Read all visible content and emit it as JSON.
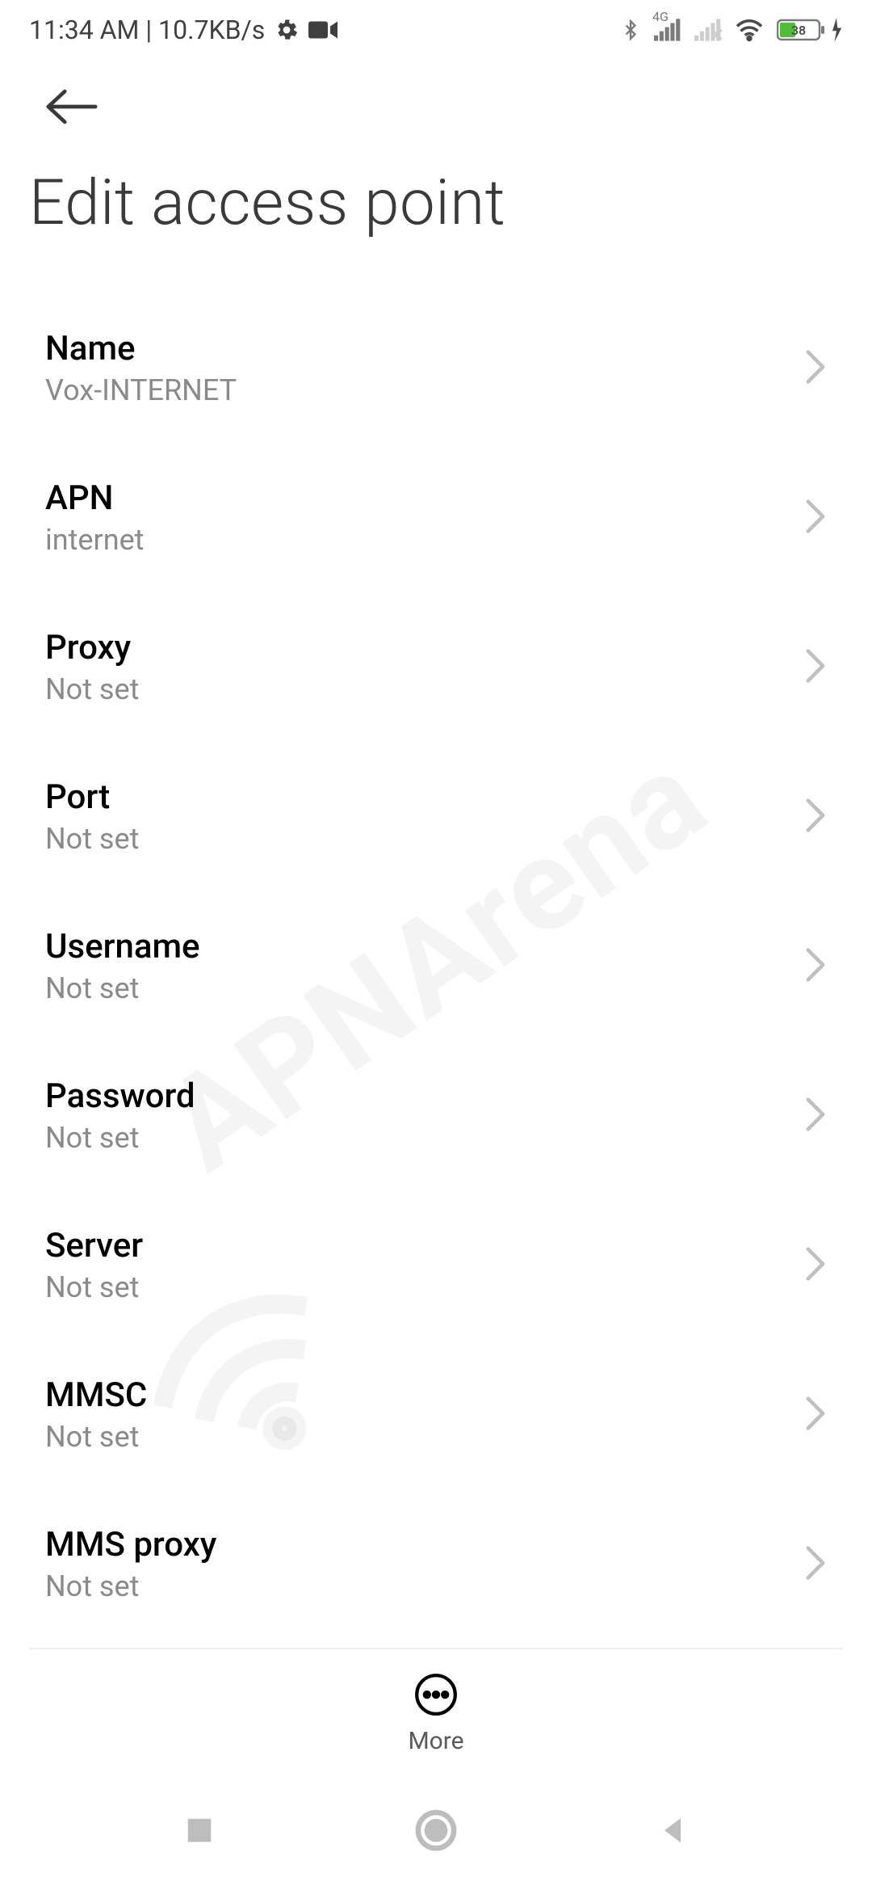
{
  "statusbar": {
    "time": "11:34 AM",
    "sep": "|",
    "speed": "10.7KB/s",
    "network_badge": "4G",
    "battery_pct": "38"
  },
  "header": {
    "title": "Edit access point"
  },
  "settings": [
    {
      "label": "Name",
      "value": "Vox-INTERNET"
    },
    {
      "label": "APN",
      "value": "internet"
    },
    {
      "label": "Proxy",
      "value": "Not set"
    },
    {
      "label": "Port",
      "value": "Not set"
    },
    {
      "label": "Username",
      "value": "Not set"
    },
    {
      "label": "Password",
      "value": "Not set"
    },
    {
      "label": "Server",
      "value": "Not set"
    },
    {
      "label": "MMSC",
      "value": "Not set"
    },
    {
      "label": "MMS proxy",
      "value": "Not set"
    }
  ],
  "bottom": {
    "more_label": "More"
  },
  "watermark": "APNArena"
}
